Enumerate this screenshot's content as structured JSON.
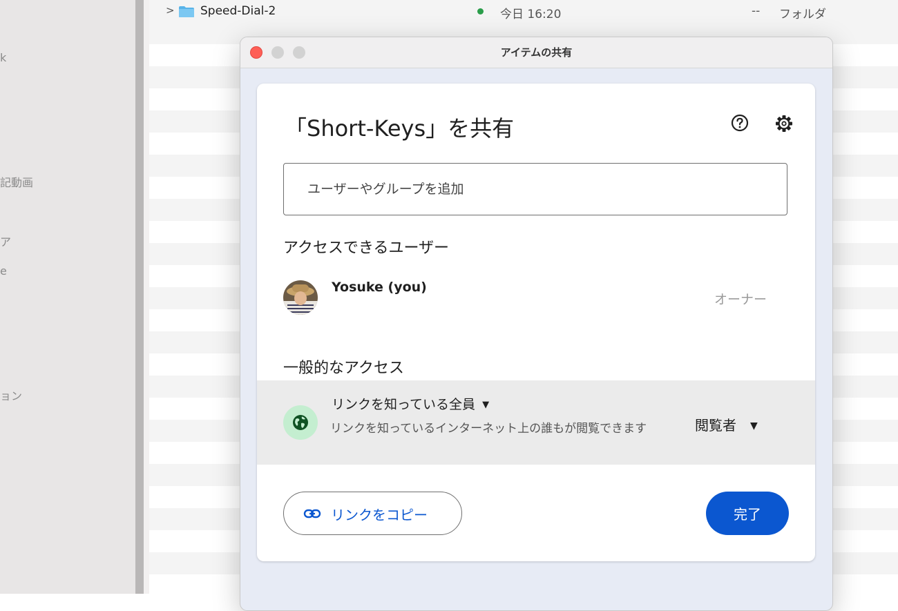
{
  "finder": {
    "sidebar_fragments": [
      "k",
      "記動画",
      "ア",
      "e",
      "ョン"
    ],
    "row": {
      "name": "Speed-Dial-2",
      "date": "今日 16:20",
      "size": "--",
      "kind": "フォルダ"
    }
  },
  "window": {
    "title": "アイテムの共有"
  },
  "share": {
    "title": "「Short-Keys」を共有",
    "add_placeholder": "ユーザーやグループを追加",
    "people_heading": "アクセスできるユーザー",
    "user_name": "Yosuke (you)",
    "user_role": "オーナー",
    "general_heading": "一般的なアクセス",
    "scope_label": "リンクを知っている全員",
    "scope_desc": "リンクを知っているインターネット上の誰もが閲覧できます",
    "role_label": "閲覧者",
    "copy_label": "リンクをコピー",
    "done_label": "完了"
  },
  "colors": {
    "accent": "#0b57d0",
    "close": "#fe5f57",
    "globe_bg": "#c4eed0",
    "globe_fg": "#0f5223"
  }
}
